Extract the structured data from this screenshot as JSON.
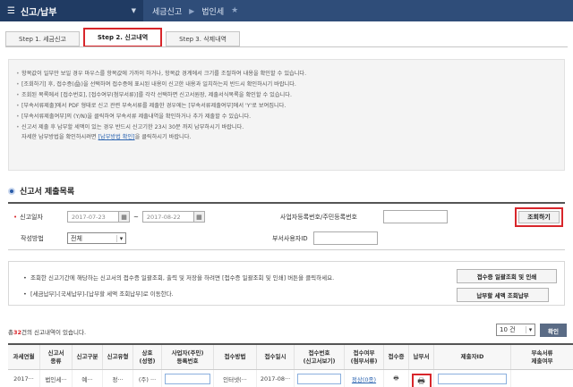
{
  "topnav": {
    "hamburger_icon": "hamburger-icon",
    "menu_label": "신고/납부",
    "crumbs": [
      "세금신고",
      "법인세"
    ]
  },
  "steps": [
    {
      "label": "Step 1. 세금신고",
      "active": false
    },
    {
      "label": "Step 2. 신고내역",
      "active": true
    },
    {
      "label": "Step 3. 삭제내역",
      "active": false
    }
  ],
  "notice": {
    "items": [
      "항목값이 일부만 보일 경우 마우스를 항목값에 가까이 하거나, 항목값 경계에서 크기를 조절하여 내용을 확인할 수 있습니다.",
      "[조회하기] 후, 접수증(🖨)을 선택하여 접수증에 표시된 내용이 신고한 내용과 일치하는지 반드시 확인하시기 바랍니다.",
      "조회된 목록에서 [접수번호], [접수여부(첨부서류)]를 각각 선택하면 신고서원장, 제출서식목록을 확인할 수 있습니다.",
      "[부속서류제출]에서 PDF 형태로 신고 관련 부속서류를 제출한 경우에는 [부속서류제출여부]에서 'Y'로 보여집니다.",
      "[부속서류제출여부]의 (Y/N)을 클릭하여 부속서류 제출내역을 확인하거나 추가 제출할 수 있습니다.",
      "신고서 제출 후 납부할 세액이 있는 경우 반드시 신고기한 23시 30분 까지 납부하시기 바랍니다."
    ],
    "sub_prefix": "자세한 납부방법을 확인하시려면",
    "sub_link": "[납부방법 확인]",
    "sub_suffix": "을 클릭하시기 바랍니다."
  },
  "section_title": "신고서 제출목록",
  "form": {
    "date_label": "신고일자",
    "date_from": "2017-07-23",
    "date_to": "2017-08-22",
    "tilde": "~",
    "biz_no_label": "사업자등록번호/주민등록번호",
    "method_label": "작성방법",
    "method_value": "전체",
    "dept_label": "부서사용자ID",
    "search_button": "조회하기"
  },
  "info": {
    "line1": "조회한 신고기간에 해당하는 신고서의 접수증 일괄조회, 출력 및 저장을 하려면 [접수증 일괄조회 및 인쇄] 버튼을 클릭하세요.",
    "line2": "[세금납부]-[국세납부]-[납부할 세액 조회납부]로 이동한다.",
    "btn_batch": "접수증 일괄조회 및 인쇄",
    "btn_pay": "납부할 세액 조회납부"
  },
  "summary": {
    "prefix": "총",
    "count": "32",
    "suffix": "건의 신고내역이 있습니다.",
    "page_size": "10 건",
    "confirm": "확인"
  },
  "table": {
    "headers": [
      "과세연월",
      "신고서\n종류",
      "신고구분",
      "신고유형",
      "상호\n(성명)",
      "사업자(주민)\n등록번호",
      "접수방법",
      "접수일시",
      "접수번호\n(신고서보기)",
      "접수여부\n(첨부서류)",
      "접수증",
      "납부서",
      "제출자ID",
      "부속서류\n제출여부"
    ],
    "row": [
      "2017···",
      "법인세···",
      "예···",
      "정···",
      "(주) ···",
      "",
      "인터넷(···",
      "2017-08···",
      "",
      "정상(0종)",
      "",
      "",
      "",
      ""
    ]
  }
}
